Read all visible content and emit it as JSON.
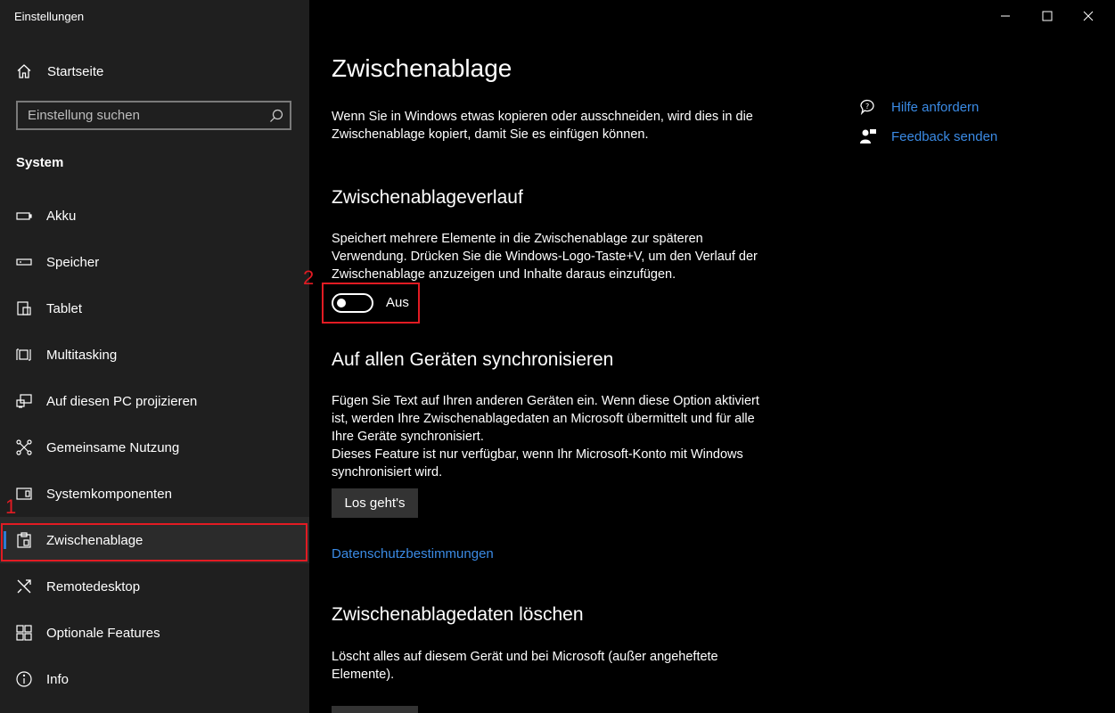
{
  "window": {
    "title": "Einstellungen"
  },
  "sidebar": {
    "home_label": "Startseite",
    "search_placeholder": "Einstellung suchen",
    "section": "System",
    "items": [
      {
        "label": "Akku",
        "icon": "battery-icon"
      },
      {
        "label": "Speicher",
        "icon": "storage-icon"
      },
      {
        "label": "Tablet",
        "icon": "tablet-icon"
      },
      {
        "label": "Multitasking",
        "icon": "multitasking-icon"
      },
      {
        "label": "Auf diesen PC projizieren",
        "icon": "project-icon"
      },
      {
        "label": "Gemeinsame Nutzung",
        "icon": "share-icon"
      },
      {
        "label": "Systemkomponenten",
        "icon": "components-icon"
      },
      {
        "label": "Zwischenablage",
        "icon": "clipboard-icon",
        "active": true
      },
      {
        "label": "Remotedesktop",
        "icon": "remote-desktop-icon"
      },
      {
        "label": "Optionale Features",
        "icon": "optional-features-icon"
      },
      {
        "label": "Info",
        "icon": "info-icon"
      }
    ]
  },
  "annotations": {
    "one": "1",
    "two": "2"
  },
  "main": {
    "title": "Zwischenablage",
    "intro": "Wenn Sie in Windows etwas kopieren oder ausschneiden, wird dies in die Zwischenablage kopiert, damit Sie es einfügen können.",
    "history": {
      "heading": "Zwischenablageverlauf",
      "desc": "Speichert mehrere Elemente in die Zwischenablage zur späteren Verwendung. Drücken Sie die Windows-Logo-Taste+V, um den Verlauf der Zwischenablage anzuzeigen und Inhalte daraus einzufügen.",
      "toggle_label": "Aus",
      "toggle_on": false
    },
    "sync": {
      "heading": "Auf allen Geräten synchronisieren",
      "desc1": "Fügen Sie Text auf Ihren anderen Geräten ein. Wenn diese Option aktiviert ist, werden Ihre Zwischenablagedaten an Microsoft übermittelt und für alle Ihre Geräte synchronisiert.",
      "desc2": "Dieses Feature ist nur verfügbar, wenn Ihr Microsoft-Konto mit Windows synchronisiert wird.",
      "button": "Los geht's"
    },
    "privacy_link": "Datenschutzbestimmungen",
    "clear": {
      "heading": "Zwischenablagedaten löschen",
      "desc": "Löscht alles auf diesem Gerät und bei Microsoft (außer angeheftete Elemente)."
    }
  },
  "help": {
    "get_help": "Hilfe anfordern",
    "feedback": "Feedback senden"
  },
  "colors": {
    "accent": "#3b8be5",
    "highlight": "#e21b23",
    "sidebar_bg": "#1f1f1f",
    "main_bg": "#000000"
  }
}
